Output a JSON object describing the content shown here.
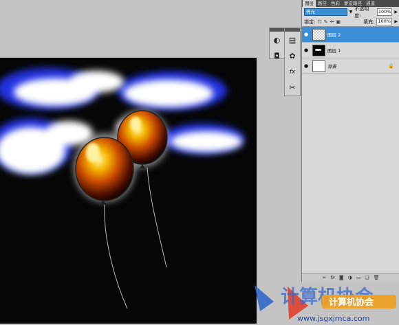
{
  "panel": {
    "tabs": [
      "图层",
      "路径",
      "色彩",
      "蒙皮路径",
      "通道"
    ],
    "blend_mode": "亮光",
    "opacity_label": "不透明度:",
    "opacity_value": "100%",
    "lock_label": "锁定:",
    "fill_label": "填充:",
    "fill_value": "100%",
    "layers": [
      {
        "name": "图层 2",
        "selected": true,
        "thumb": "transparent"
      },
      {
        "name": "图层 1",
        "selected": false,
        "thumb": "dark"
      },
      {
        "name": "背景",
        "selected": false,
        "thumb": "white",
        "locked": true
      }
    ],
    "bottom_icons": [
      "link-icon",
      "fx-icon",
      "mask-icon",
      "adjustment-icon",
      "folder-icon",
      "new-layer-icon",
      "trash-icon"
    ]
  },
  "tools": [
    {
      "icon": "brush-options-icon",
      "glyph": "◐"
    },
    {
      "icon": "swatch-icon",
      "glyph": "◘"
    },
    {
      "icon": "histogram-icon",
      "glyph": "▤"
    },
    {
      "icon": "styles-icon",
      "glyph": "✿"
    },
    {
      "icon": "fx-panel-icon",
      "glyph": "fx"
    },
    {
      "icon": "tools-preset-icon",
      "glyph": "✂"
    }
  ],
  "watermark": {
    "title": "计算机协会",
    "url": "www.jsgxjmca.com",
    "badge": "计算机协会"
  },
  "colors": {
    "accent": "#3a8ed8",
    "canvas_bg": "#060606",
    "app_bg": "#c4c4c4"
  }
}
